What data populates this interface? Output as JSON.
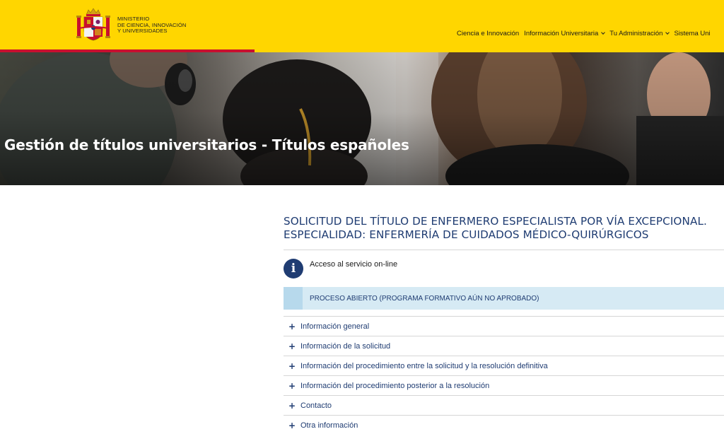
{
  "header": {
    "ministry_lines": [
      "MINISTERIO",
      "DE CIENCIA, INNOVACIÓN",
      "Y UNIVERSIDADES"
    ],
    "colors": {
      "bar": "#ffd600",
      "accent": "#c8102e"
    },
    "nav": [
      {
        "label": "Ciencia e Innovación",
        "has_dropdown": false
      },
      {
        "label": "Información Universitaria",
        "has_dropdown": true
      },
      {
        "label": "Tu Administración",
        "has_dropdown": true
      },
      {
        "label": "Sistema Uni",
        "has_dropdown": false
      }
    ]
  },
  "hero": {
    "title": "Gestión de títulos universitarios - Títulos españoles"
  },
  "main": {
    "title_lines": [
      "SOLICITUD DEL TÍTULO DE ENFERMERO ESPECIALISTA POR VÍA EXCEPCIONAL.",
      "ESPECIALIDAD: ENFERMERÍA DE CUIDADOS MÉDICO-QUIRÚRGICOS"
    ],
    "access_link": "Acceso al servicio on-line",
    "info_icon": "info-icon",
    "process_status": "PROCESO ABIERTO (PROGRAMA FORMATIVO AÚN NO APROBADO)",
    "accordion": [
      {
        "label": "Información general"
      },
      {
        "label": "Información de la solicitud"
      },
      {
        "label": "Información del procedimiento entre la solicitud y la resolución definitiva"
      },
      {
        "label": "Información del procedimiento posterior a la resolución"
      },
      {
        "label": "Contacto"
      },
      {
        "label": "Otra información"
      }
    ],
    "colors": {
      "title": "#1f3c72",
      "process_bg": "#d6eaf4"
    }
  }
}
